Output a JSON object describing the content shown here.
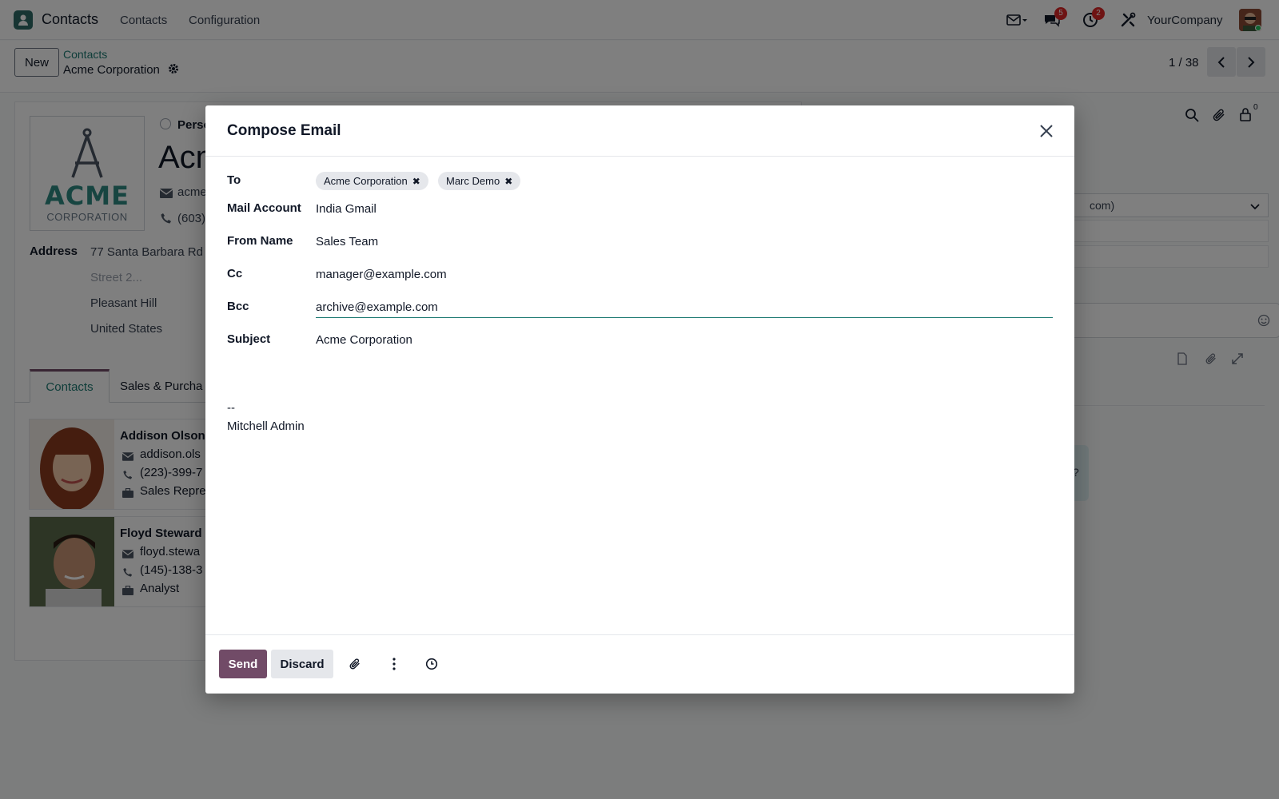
{
  "navbar": {
    "app_name": "Contacts",
    "menu": [
      "Contacts",
      "Configuration"
    ],
    "messages_badge": "5",
    "activities_badge": "2",
    "company": "YourCompany"
  },
  "control": {
    "new_label": "New",
    "breadcrumb_parent": "Contacts",
    "breadcrumb_current": "Acme Corporation",
    "pager": "1 / 38"
  },
  "form": {
    "person_radio": "Perso",
    "name_partial": "Acm",
    "email_partial": "acme",
    "phone_partial": "(603)",
    "address_label": "Address",
    "street": "77 Santa Barbara Rd",
    "street2_placeholder": "Street 2...",
    "city": "Pleasant Hill",
    "country": "United States",
    "logo_word": "ACME",
    "logo_sub": "CORPORATION",
    "tabs": [
      "Contacts",
      "Sales & Purcha"
    ],
    "contacts": [
      {
        "name": "Addison Olson",
        "email": "addison.ols",
        "phone": "(223)-399-7",
        "job": "Sales Repre"
      },
      {
        "name": "Floyd Steward",
        "email": "floyd.stewa",
        "phone": "(145)-138-3",
        "job": "Analyst"
      }
    ]
  },
  "chatter": {
    "select_partial": "com)",
    "bubble_partial": "?",
    "followers_count": "0"
  },
  "modal": {
    "title": "Compose Email",
    "fields": {
      "to_label": "To",
      "to_tags": [
        "Acme Corporation",
        "Marc Demo"
      ],
      "mail_account_label": "Mail Account",
      "mail_account_value": "India Gmail",
      "from_name_label": "From Name",
      "from_name_value": "Sales Team",
      "cc_label": "Cc",
      "cc_value": "manager@example.com",
      "bcc_label": "Bcc",
      "bcc_value": "archive@example.com",
      "subject_label": "Subject",
      "subject_value": "Acme Corporation"
    },
    "body": {
      "signature_sep": "--",
      "signature_name": "Mitchell Admin"
    },
    "footer": {
      "send_label": "Send",
      "discard_label": "Discard"
    }
  },
  "colors": {
    "primary": "#714b67",
    "teal": "#1d7a73",
    "logo_teal": "#2e8a83"
  }
}
